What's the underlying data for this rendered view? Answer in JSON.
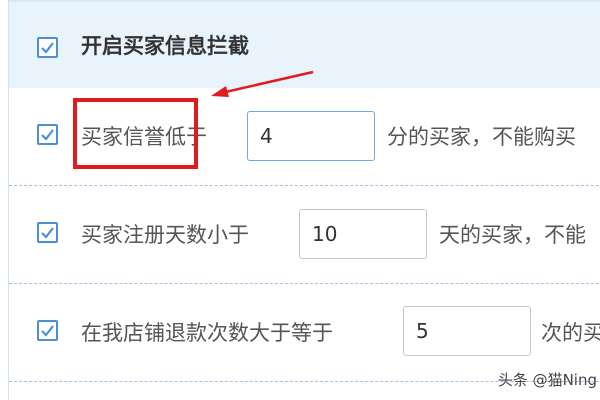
{
  "header": {
    "checkbox_checked": true,
    "title": "开启买家信息拦截"
  },
  "rules": [
    {
      "checked": true,
      "prefix": "买家信誉低于",
      "value": "4",
      "suffix": "分的买家，不能购买"
    },
    {
      "checked": true,
      "prefix": "买家注册天数小于",
      "value": "10",
      "suffix": "天的买家，不能"
    },
    {
      "checked": true,
      "prefix": "在我店铺退款次数大于等于",
      "value": "5",
      "suffix": "次的买家"
    }
  ],
  "annotation": {
    "highlight_color": "#e01b1b",
    "arrow_color": "#e01b1b"
  },
  "watermark": "头条 @猫Ning",
  "colors": {
    "accent": "#4a8fd8",
    "header_bg": "#e8f3fc",
    "divider": "#9fc3e6"
  }
}
